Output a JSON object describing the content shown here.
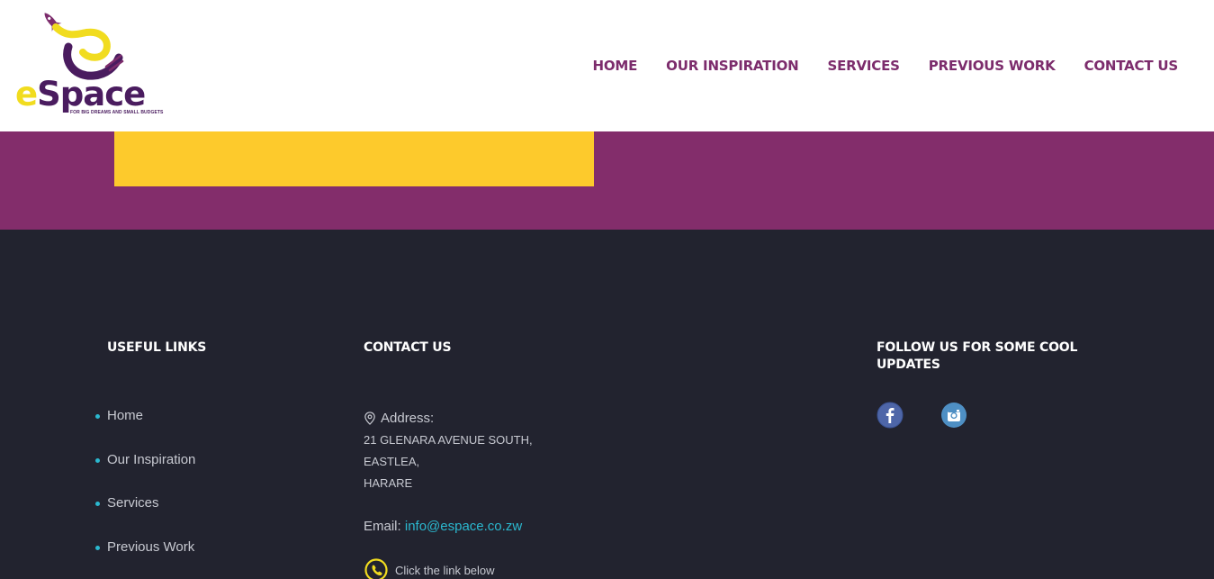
{
  "brand": {
    "name_e": "e",
    "name_rest": "Space",
    "tagline": "FOR BIG DREAMS AND SMALL BUDGETS"
  },
  "nav": {
    "items": [
      {
        "label": "HOME"
      },
      {
        "label": "OUR INSPIRATION"
      },
      {
        "label": "SERVICES"
      },
      {
        "label": "PREVIOUS WORK"
      },
      {
        "label": "CONTACT US"
      }
    ]
  },
  "footer": {
    "useful_links": {
      "title": "USEFUL LINKS",
      "items": [
        {
          "label": "Home"
        },
        {
          "label": "Our Inspiration"
        },
        {
          "label": "Services"
        },
        {
          "label": "Previous Work"
        }
      ]
    },
    "contact": {
      "title": "CONTACT US",
      "address_label": "Address:",
      "address_lines": [
        "21 GLENARA AVENUE SOUTH,",
        "EASTLEA,",
        "HARARE"
      ],
      "email_label": "Email:",
      "email": "info@espace.co.zw",
      "phone_text": "Click the link below"
    },
    "follow": {
      "title": "FOLLOW US FOR SOME COOL UPDATES",
      "icons": [
        "facebook-icon",
        "instagram-icon"
      ]
    }
  },
  "colors": {
    "brand_purple": "#832d6b",
    "nav_purple": "#7c2c6c",
    "accent_yellow": "#fdca2c",
    "footer_bg": "#22232f",
    "link_cyan": "#2bb8cf"
  }
}
